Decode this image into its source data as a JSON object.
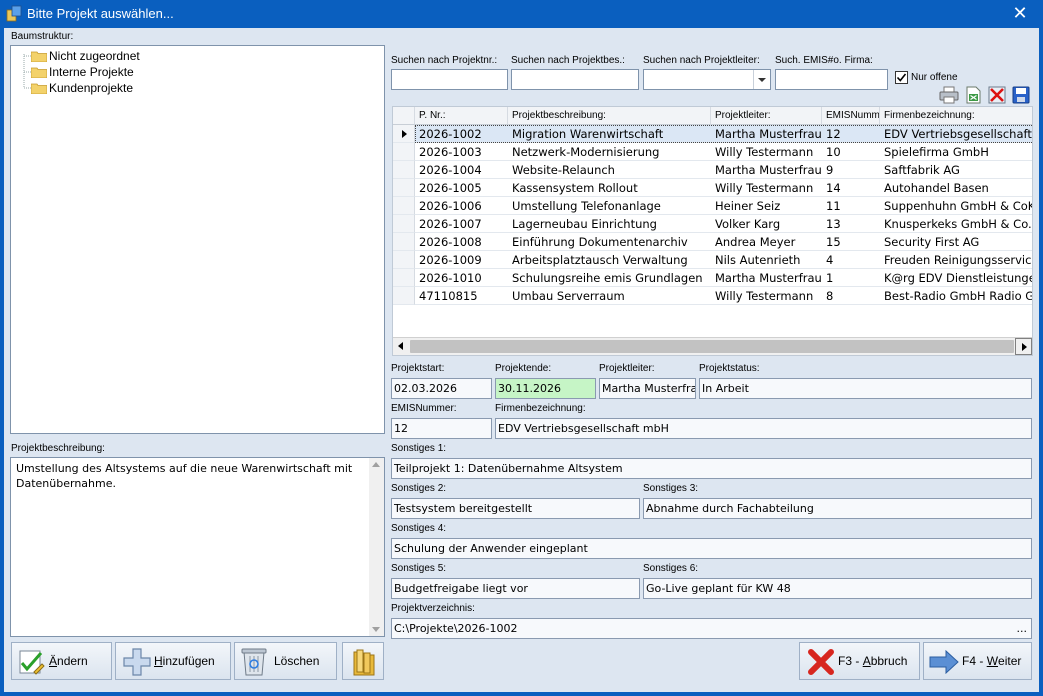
{
  "window": {
    "title": "Bitte Projekt auswählen...",
    "close": "✕"
  },
  "tree": {
    "label": "Baumstruktur:",
    "nodes": [
      "Nicht zugeordnet",
      "Interne Projekte",
      "Kundenprojekte"
    ]
  },
  "description": {
    "label": "Projektbeschreibung:",
    "text": "Umstellung des Altsystems auf die neue Warenwirtschaft mit Datenübernahme."
  },
  "search": {
    "label_nr": "Suchen nach Projektnr.:",
    "label_bes": "Suchen nach Projektbes.:",
    "label_leiter": "Suchen nach Projektleiter:",
    "label_emis": "Such. EMIS#o. Firma:",
    "nr_value": "",
    "bes_value": "",
    "leiter_value": "",
    "emis_value": "",
    "nur_offene_label": "Nur offene",
    "nur_offene_checked": true
  },
  "toolbar_icons": [
    "print-icon",
    "export-excel-icon",
    "delete-layout-icon",
    "save-icon"
  ],
  "grid": {
    "columns": [
      "P. Nr.:",
      "Projektbeschreibung:",
      "Projektleiter:",
      "EMISNummer:",
      "Firmenbezeichnung:"
    ],
    "rows": [
      [
        "2026-1002",
        "Migration Warenwirtschaft",
        "Martha Musterfrau",
        "12",
        "EDV Vertriebsgesellschaft mbH"
      ],
      [
        "2026-1003",
        "Netzwerk-Modernisierung",
        "Willy Testermann",
        "10",
        "Spielefirma GmbH"
      ],
      [
        "2026-1004",
        "Website-Relaunch",
        "Martha Musterfrau",
        "9",
        "Saftfabrik AG"
      ],
      [
        "2026-1005",
        "Kassensystem Rollout",
        "Willy Testermann",
        "14",
        "Autohandel Basen"
      ],
      [
        "2026-1006",
        "Umstellung Telefonanlage",
        "Heiner Seiz",
        "11",
        "Suppenhuhn GmbH & CoKG"
      ],
      [
        "2026-1007",
        "Lagerneubau Einrichtung",
        "Volker Karg",
        "13",
        "Knusperkeks GmbH & Co. KG"
      ],
      [
        "2026-1008",
        "Einführung Dokumentenarchiv",
        "Andrea Meyer",
        "15",
        "Security First AG"
      ],
      [
        "2026-1009",
        "Arbeitsplatztausch Verwaltung",
        "Nils Autenrieth",
        "4",
        "Freuden Reinigungsservice GmbH"
      ],
      [
        "2026-1010",
        "Schulungsreihe emis Grundlagen",
        "Martha Musterfrau",
        "1",
        "K@rg EDV Dienstleistungen"
      ],
      [
        "47110815",
        "Umbau Serverraum",
        "Willy Testermann",
        "8",
        "Best-Radio GmbH Radio Grosshandel"
      ]
    ],
    "selected_row": 0
  },
  "details": {
    "projektstart_label": "Projektstart:",
    "projektstart": "02.03.2026",
    "projektende_label": "Projektende:",
    "projektende": "30.11.2026",
    "projektleiter_label": "Projektleiter:",
    "projektleiter": "Martha Musterfrau",
    "projektstatus_label": "Projektstatus:",
    "projektstatus": "In Arbeit",
    "emis_label": "EMISNummer:",
    "emis": "12",
    "firma_label": "Firmenbezeichnung:",
    "firma": "EDV Vertriebsgesellschaft mbH",
    "sonstiges1_label": "Sonstiges 1:",
    "sonstiges1": "Teilprojekt 1: Datenübernahme Altsystem",
    "sonstiges2_label": "Sonstiges 2:",
    "sonstiges2": "Testsystem bereitgestellt",
    "sonstiges3_label": "Sonstiges 3:",
    "sonstiges3": "Abnahme durch Fachabteilung",
    "sonstiges4_label": "Sonstiges 4:",
    "sonstiges4": "Schulung der Anwender eingeplant",
    "sonstiges5_label": "Sonstiges 5:",
    "sonstiges5": "Budgetfreigabe liegt vor",
    "sonstiges6_label": "Sonstiges 6:",
    "sonstiges6": "Go-Live geplant für KW 48",
    "verzeichnis_label": "Projektverzeichnis:",
    "verzeichnis": "C:\\Projekte\\2026-1002",
    "verzeichnis_browse": "..."
  },
  "buttons": {
    "aendern_accel": "Ä",
    "aendern_rest": "ndern",
    "hinzu_accel": "H",
    "hinzu_rest": "inzufügen",
    "loeschen": "Löschen",
    "abbruch_prefix": "F3 - ",
    "abbruch_accel": "A",
    "abbruch_rest": "bbruch",
    "weiter_prefix": "F4 - ",
    "weiter_accel": "W",
    "weiter_rest": "eiter"
  },
  "colors": {
    "titlebar": "#0a5fbf",
    "client_bg": "#dde6f1",
    "highlight_green": "#c6f5c6",
    "selected_row": "#dbe7f5"
  }
}
